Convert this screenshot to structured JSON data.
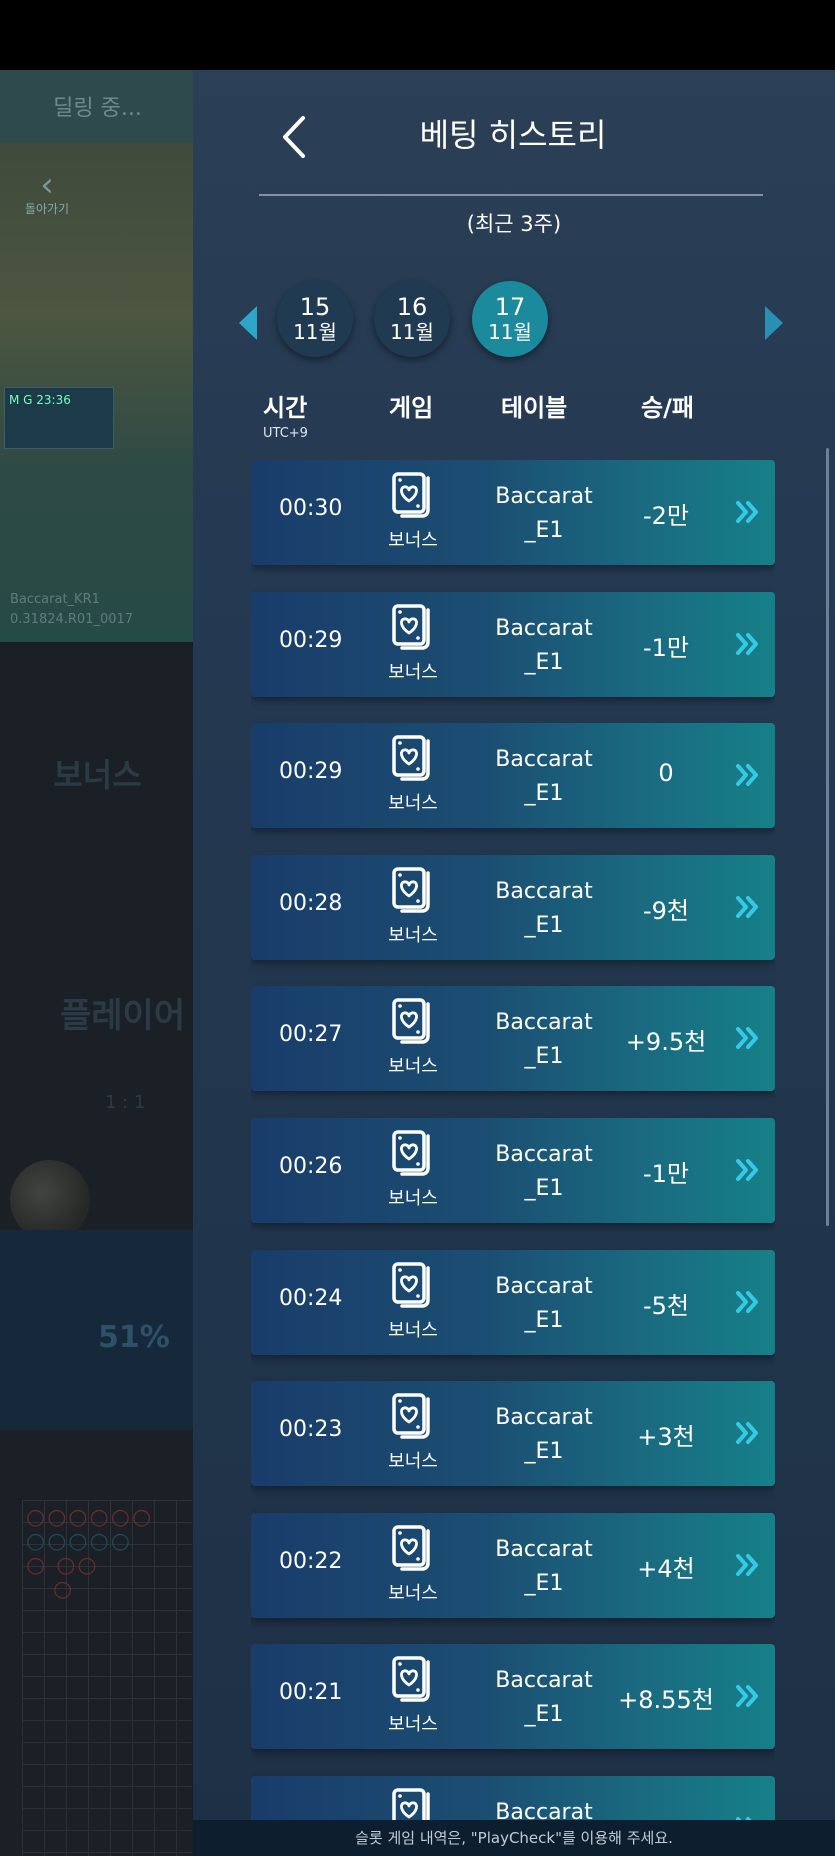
{
  "backdrop": {
    "status": "딜링 중...",
    "back_label": "돌아가기",
    "mg_text": "M G  23:36",
    "caption": "Baccarat_KR1\n0.31824.R01_0017",
    "bonus": "보너스",
    "player": "플레이어",
    "ratio": "1 : 1",
    "percent": "51%"
  },
  "header": {
    "title": "베팅 히스토리",
    "back_icon": "chevron-left-icon",
    "subtitle": "(최근 3주)"
  },
  "dates": [
    {
      "day": "15",
      "month": "11월",
      "active": false
    },
    {
      "day": "16",
      "month": "11월",
      "active": false
    },
    {
      "day": "17",
      "month": "11월",
      "active": true
    }
  ],
  "columns": {
    "time": "시간",
    "timezone": "UTC+9",
    "game": "게임",
    "table": "테이블",
    "winloss": "승/패"
  },
  "rows": [
    {
      "time": "00:30",
      "game": "보너스",
      "table_line1": "Baccarat",
      "table_line2": "_E1",
      "result": "-2만"
    },
    {
      "time": "00:29",
      "game": "보너스",
      "table_line1": "Baccarat",
      "table_line2": "_E1",
      "result": "-1만"
    },
    {
      "time": "00:29",
      "game": "보너스",
      "table_line1": "Baccarat",
      "table_line2": "_E1",
      "result": "0"
    },
    {
      "time": "00:28",
      "game": "보너스",
      "table_line1": "Baccarat",
      "table_line2": "_E1",
      "result": "-9천"
    },
    {
      "time": "00:27",
      "game": "보너스",
      "table_line1": "Baccarat",
      "table_line2": "_E1",
      "result": "+9.5천"
    },
    {
      "time": "00:26",
      "game": "보너스",
      "table_line1": "Baccarat",
      "table_line2": "_E1",
      "result": "-1만"
    },
    {
      "time": "00:24",
      "game": "보너스",
      "table_line1": "Baccarat",
      "table_line2": "_E1",
      "result": "-5천"
    },
    {
      "time": "00:23",
      "game": "보너스",
      "table_line1": "Baccarat",
      "table_line2": "_E1",
      "result": "+3천"
    },
    {
      "time": "00:22",
      "game": "보너스",
      "table_line1": "Baccarat",
      "table_line2": "_E1",
      "result": "+4천"
    },
    {
      "time": "00:21",
      "game": "보너스",
      "table_line1": "Baccarat",
      "table_line2": "_E1",
      "result": "+8.55천"
    },
    {
      "time": "",
      "game": "",
      "table_line1": "Baccarat",
      "table_line2": "",
      "result": ""
    }
  ],
  "footer": "슬롯 게임 내역은, \"PlayCheck\"를 이용해 주세요.",
  "colors": {
    "accent": "#2ea6c9",
    "active_date": "#1a8a9c",
    "panel_bg": "#253a52"
  }
}
